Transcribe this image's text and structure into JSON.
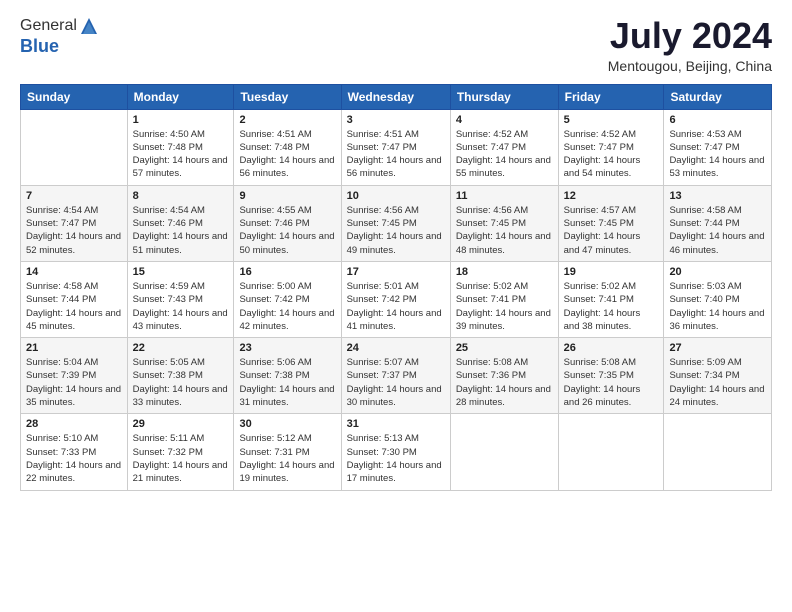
{
  "logo": {
    "general": "General",
    "blue": "Blue"
  },
  "header": {
    "month": "July 2024",
    "location": "Mentougou, Beijing, China"
  },
  "weekdays": [
    "Sunday",
    "Monday",
    "Tuesday",
    "Wednesday",
    "Thursday",
    "Friday",
    "Saturday"
  ],
  "weeks": [
    [
      {
        "day": "",
        "sunrise": "",
        "sunset": "",
        "daylight": ""
      },
      {
        "day": "1",
        "sunrise": "Sunrise: 4:50 AM",
        "sunset": "Sunset: 7:48 PM",
        "daylight": "Daylight: 14 hours and 57 minutes."
      },
      {
        "day": "2",
        "sunrise": "Sunrise: 4:51 AM",
        "sunset": "Sunset: 7:48 PM",
        "daylight": "Daylight: 14 hours and 56 minutes."
      },
      {
        "day": "3",
        "sunrise": "Sunrise: 4:51 AM",
        "sunset": "Sunset: 7:47 PM",
        "daylight": "Daylight: 14 hours and 56 minutes."
      },
      {
        "day": "4",
        "sunrise": "Sunrise: 4:52 AM",
        "sunset": "Sunset: 7:47 PM",
        "daylight": "Daylight: 14 hours and 55 minutes."
      },
      {
        "day": "5",
        "sunrise": "Sunrise: 4:52 AM",
        "sunset": "Sunset: 7:47 PM",
        "daylight": "Daylight: 14 hours and 54 minutes."
      },
      {
        "day": "6",
        "sunrise": "Sunrise: 4:53 AM",
        "sunset": "Sunset: 7:47 PM",
        "daylight": "Daylight: 14 hours and 53 minutes."
      }
    ],
    [
      {
        "day": "7",
        "sunrise": "Sunrise: 4:54 AM",
        "sunset": "Sunset: 7:47 PM",
        "daylight": "Daylight: 14 hours and 52 minutes."
      },
      {
        "day": "8",
        "sunrise": "Sunrise: 4:54 AM",
        "sunset": "Sunset: 7:46 PM",
        "daylight": "Daylight: 14 hours and 51 minutes."
      },
      {
        "day": "9",
        "sunrise": "Sunrise: 4:55 AM",
        "sunset": "Sunset: 7:46 PM",
        "daylight": "Daylight: 14 hours and 50 minutes."
      },
      {
        "day": "10",
        "sunrise": "Sunrise: 4:56 AM",
        "sunset": "Sunset: 7:45 PM",
        "daylight": "Daylight: 14 hours and 49 minutes."
      },
      {
        "day": "11",
        "sunrise": "Sunrise: 4:56 AM",
        "sunset": "Sunset: 7:45 PM",
        "daylight": "Daylight: 14 hours and 48 minutes."
      },
      {
        "day": "12",
        "sunrise": "Sunrise: 4:57 AM",
        "sunset": "Sunset: 7:45 PM",
        "daylight": "Daylight: 14 hours and 47 minutes."
      },
      {
        "day": "13",
        "sunrise": "Sunrise: 4:58 AM",
        "sunset": "Sunset: 7:44 PM",
        "daylight": "Daylight: 14 hours and 46 minutes."
      }
    ],
    [
      {
        "day": "14",
        "sunrise": "Sunrise: 4:58 AM",
        "sunset": "Sunset: 7:44 PM",
        "daylight": "Daylight: 14 hours and 45 minutes."
      },
      {
        "day": "15",
        "sunrise": "Sunrise: 4:59 AM",
        "sunset": "Sunset: 7:43 PM",
        "daylight": "Daylight: 14 hours and 43 minutes."
      },
      {
        "day": "16",
        "sunrise": "Sunrise: 5:00 AM",
        "sunset": "Sunset: 7:42 PM",
        "daylight": "Daylight: 14 hours and 42 minutes."
      },
      {
        "day": "17",
        "sunrise": "Sunrise: 5:01 AM",
        "sunset": "Sunset: 7:42 PM",
        "daylight": "Daylight: 14 hours and 41 minutes."
      },
      {
        "day": "18",
        "sunrise": "Sunrise: 5:02 AM",
        "sunset": "Sunset: 7:41 PM",
        "daylight": "Daylight: 14 hours and 39 minutes."
      },
      {
        "day": "19",
        "sunrise": "Sunrise: 5:02 AM",
        "sunset": "Sunset: 7:41 PM",
        "daylight": "Daylight: 14 hours and 38 minutes."
      },
      {
        "day": "20",
        "sunrise": "Sunrise: 5:03 AM",
        "sunset": "Sunset: 7:40 PM",
        "daylight": "Daylight: 14 hours and 36 minutes."
      }
    ],
    [
      {
        "day": "21",
        "sunrise": "Sunrise: 5:04 AM",
        "sunset": "Sunset: 7:39 PM",
        "daylight": "Daylight: 14 hours and 35 minutes."
      },
      {
        "day": "22",
        "sunrise": "Sunrise: 5:05 AM",
        "sunset": "Sunset: 7:38 PM",
        "daylight": "Daylight: 14 hours and 33 minutes."
      },
      {
        "day": "23",
        "sunrise": "Sunrise: 5:06 AM",
        "sunset": "Sunset: 7:38 PM",
        "daylight": "Daylight: 14 hours and 31 minutes."
      },
      {
        "day": "24",
        "sunrise": "Sunrise: 5:07 AM",
        "sunset": "Sunset: 7:37 PM",
        "daylight": "Daylight: 14 hours and 30 minutes."
      },
      {
        "day": "25",
        "sunrise": "Sunrise: 5:08 AM",
        "sunset": "Sunset: 7:36 PM",
        "daylight": "Daylight: 14 hours and 28 minutes."
      },
      {
        "day": "26",
        "sunrise": "Sunrise: 5:08 AM",
        "sunset": "Sunset: 7:35 PM",
        "daylight": "Daylight: 14 hours and 26 minutes."
      },
      {
        "day": "27",
        "sunrise": "Sunrise: 5:09 AM",
        "sunset": "Sunset: 7:34 PM",
        "daylight": "Daylight: 14 hours and 24 minutes."
      }
    ],
    [
      {
        "day": "28",
        "sunrise": "Sunrise: 5:10 AM",
        "sunset": "Sunset: 7:33 PM",
        "daylight": "Daylight: 14 hours and 22 minutes."
      },
      {
        "day": "29",
        "sunrise": "Sunrise: 5:11 AM",
        "sunset": "Sunset: 7:32 PM",
        "daylight": "Daylight: 14 hours and 21 minutes."
      },
      {
        "day": "30",
        "sunrise": "Sunrise: 5:12 AM",
        "sunset": "Sunset: 7:31 PM",
        "daylight": "Daylight: 14 hours and 19 minutes."
      },
      {
        "day": "31",
        "sunrise": "Sunrise: 5:13 AM",
        "sunset": "Sunset: 7:30 PM",
        "daylight": "Daylight: 14 hours and 17 minutes."
      },
      {
        "day": "",
        "sunrise": "",
        "sunset": "",
        "daylight": ""
      },
      {
        "day": "",
        "sunrise": "",
        "sunset": "",
        "daylight": ""
      },
      {
        "day": "",
        "sunrise": "",
        "sunset": "",
        "daylight": ""
      }
    ]
  ]
}
